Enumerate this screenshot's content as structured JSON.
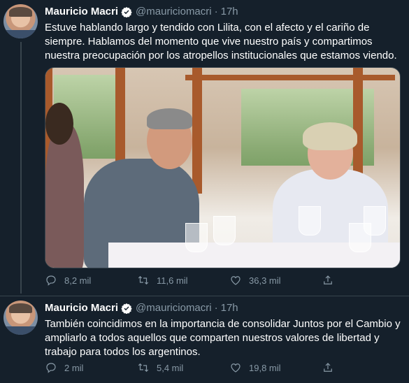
{
  "tweets": [
    {
      "author_name": "Mauricio Macri",
      "handle": "@mauriciomacri",
      "separator": "·",
      "time": "17h",
      "text": "Estuve hablando largo y tendido con Lilita, con el afecto y el cariño de siempre. Hablamos del momento que vive nuestro país y compartimos nuestra preocupación por los atropellos institucionales que estamos viendo.",
      "actions": {
        "replies": "8,2 mil",
        "retweets": "11,6 mil",
        "likes": "36,3 mil"
      },
      "icons": [
        "verified-icon",
        "reply-icon",
        "retweet-icon",
        "like-icon",
        "share-icon"
      ]
    },
    {
      "author_name": "Mauricio Macri",
      "handle": "@mauriciomacri",
      "separator": "·",
      "time": "17h",
      "text": "También coincidimos en la importancia de consolidar Juntos por el Cambio y ampliarlo a todos aquellos que comparten nuestros valores de libertad y trabajo para todos los argentinos.",
      "actions": {
        "replies": "2 mil",
        "retweets": "5,4 mil",
        "likes": "19,8 mil"
      },
      "icons": [
        "verified-icon",
        "reply-icon",
        "retweet-icon",
        "like-icon",
        "share-icon"
      ]
    }
  ],
  "colors": {
    "background": "#15202b",
    "text": "#ffffff",
    "secondary_text": "#8899a6",
    "verified": "#1da1f2",
    "divider": "#38444d"
  }
}
